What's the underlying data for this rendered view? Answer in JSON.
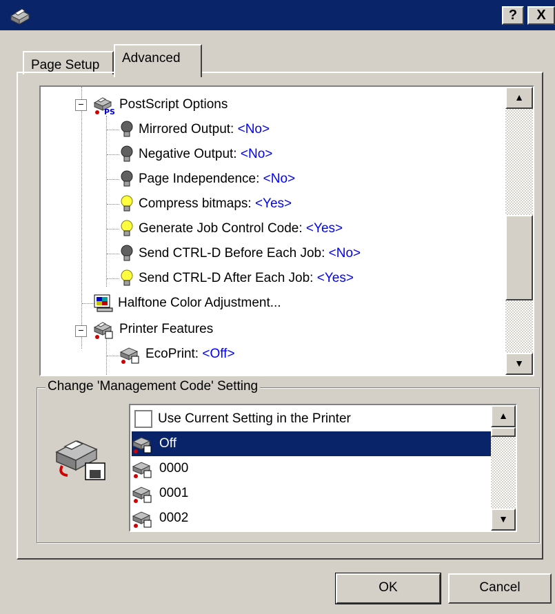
{
  "window": {
    "help_label": "?",
    "close_label": "X"
  },
  "tabs": [
    {
      "label": "Page Setup",
      "active": false
    },
    {
      "label": "Advanced",
      "active": true
    }
  ],
  "tree": {
    "items": [
      {
        "name": "postscript-options",
        "label": "PostScript Options",
        "value": null,
        "icon": "postscript-printer-icon",
        "expanded": true
      },
      {
        "name": "mirrored-output",
        "label": "Mirrored Output: ",
        "value": "<No>",
        "icon": "bulb-off-icon"
      },
      {
        "name": "negative-output",
        "label": "Negative Output: ",
        "value": "<No>",
        "icon": "bulb-off-icon"
      },
      {
        "name": "page-independence",
        "label": "Page Independence: ",
        "value": "<No>",
        "icon": "bulb-off-icon"
      },
      {
        "name": "compress-bitmaps",
        "label": "Compress bitmaps: ",
        "value": "<Yes>",
        "icon": "bulb-on-icon"
      },
      {
        "name": "generate-job-control-code",
        "label": "Generate Job Control Code: ",
        "value": "<Yes>",
        "icon": "bulb-on-icon"
      },
      {
        "name": "send-ctrl-d-before",
        "label": "Send CTRL-D Before Each Job: ",
        "value": "<No>",
        "icon": "bulb-off-icon"
      },
      {
        "name": "send-ctrl-d-after",
        "label": "Send CTRL-D After Each Job: ",
        "value": "<Yes>",
        "icon": "bulb-on-icon"
      },
      {
        "name": "halftone-color-adjustment",
        "label": "Halftone Color Adjustment...",
        "value": null,
        "icon": "halftone-icon"
      },
      {
        "name": "printer-features",
        "label": "Printer Features",
        "value": null,
        "icon": "printer-features-icon",
        "expanded": true
      },
      {
        "name": "ecoprint",
        "label": "EcoPrint: ",
        "value": "<Off>",
        "icon": "printer-feature-icon"
      }
    ]
  },
  "group": {
    "label": "Change 'Management Code' Setting",
    "icon": "printer-disk-icon"
  },
  "list": {
    "items": [
      {
        "label": "Use Current Setting in the Printer",
        "icon": "checkbox-icon",
        "selected": false
      },
      {
        "label": "Off",
        "icon": "printer-feature-icon",
        "selected": true
      },
      {
        "label": "0000",
        "icon": "printer-feature-icon",
        "selected": false
      },
      {
        "label": "0001",
        "icon": "printer-feature-icon",
        "selected": false
      },
      {
        "label": "0002",
        "icon": "printer-feature-icon",
        "selected": false
      }
    ]
  },
  "buttons": {
    "ok": "OK",
    "cancel": "Cancel"
  },
  "colors": {
    "title_bar": "#0a246a",
    "value_text": "#0000ff",
    "selection": "#0a246a",
    "face": "#d4d0c8"
  }
}
